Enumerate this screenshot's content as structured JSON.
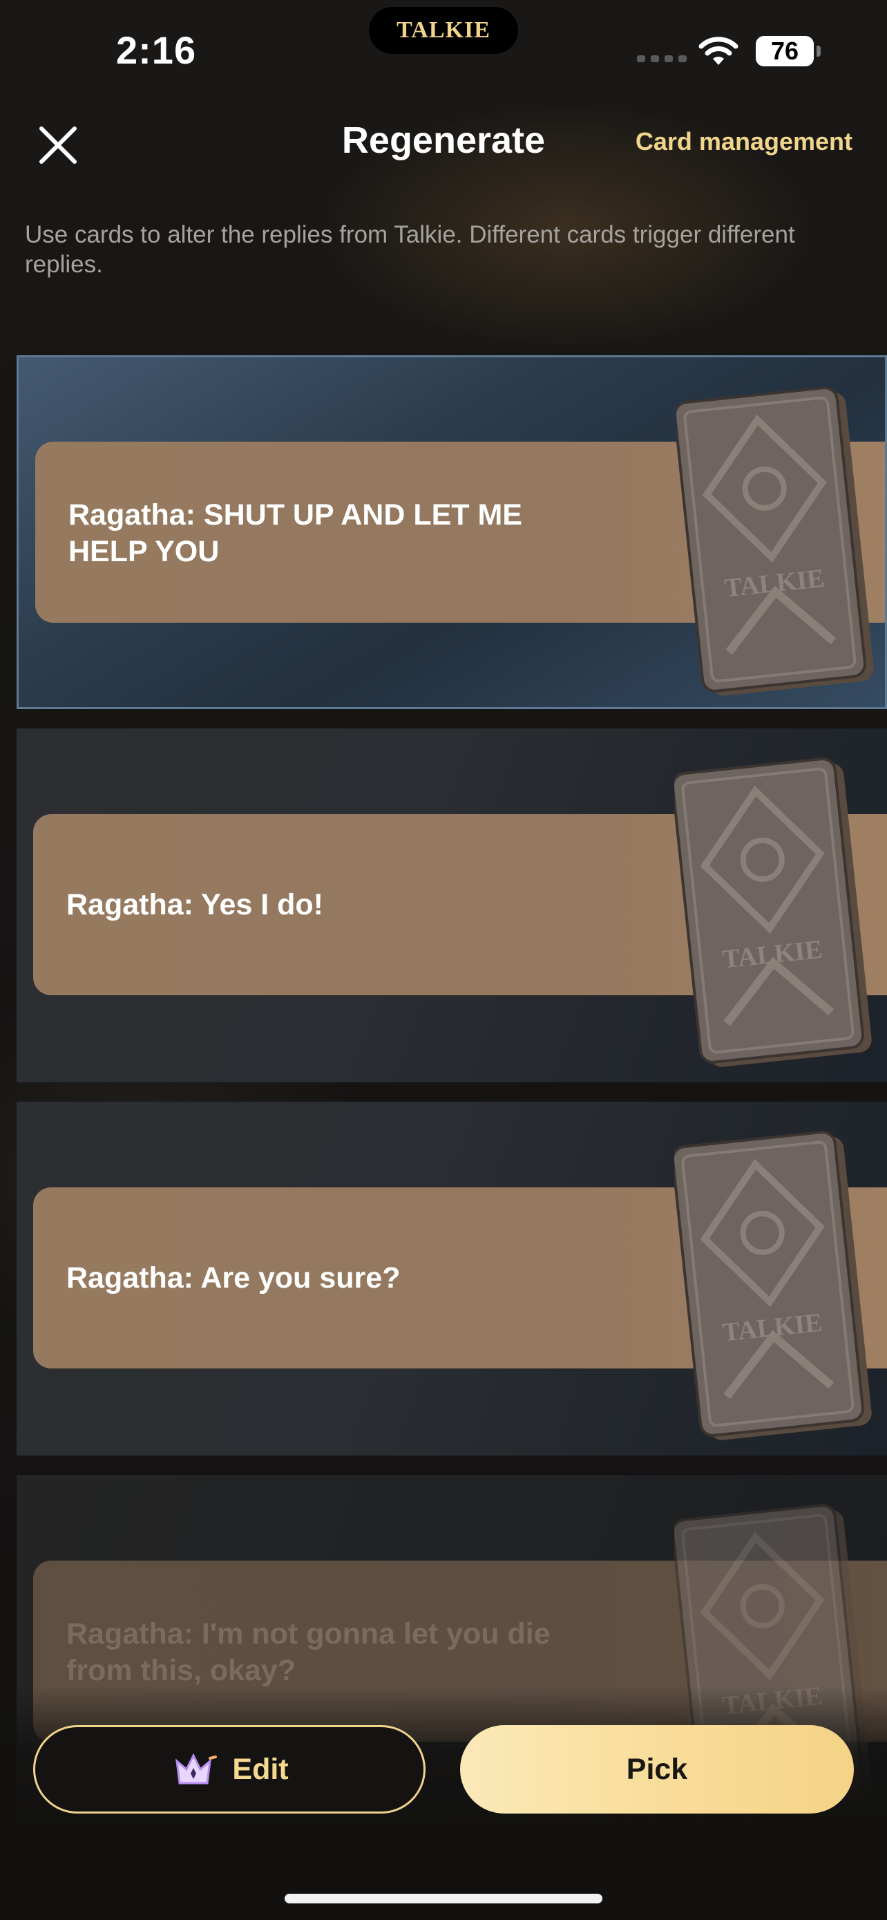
{
  "status_bar": {
    "time": "2:16",
    "island_logo": "TALKIE",
    "battery": "76"
  },
  "header": {
    "title": "Regenerate",
    "card_management": "Card management"
  },
  "description": "Use cards to alter the replies from Talkie. Different cards trigger different replies.",
  "cards": [
    {
      "text": "Ragatha: SHUT UP AND LET ME HELP YOU",
      "selected": true
    },
    {
      "text": "Ragatha: Yes I do!",
      "selected": false
    },
    {
      "text": "Ragatha: Are you sure?",
      "selected": false
    },
    {
      "text": "Ragatha: I'm not gonna let you die from this, okay?",
      "selected": false
    }
  ],
  "deck_logo": "TALKIE",
  "buttons": {
    "edit": "Edit",
    "pick": "Pick"
  },
  "colors": {
    "accent": "#f2d58c",
    "band": "#957a60",
    "selected_border": "#5d7993"
  }
}
